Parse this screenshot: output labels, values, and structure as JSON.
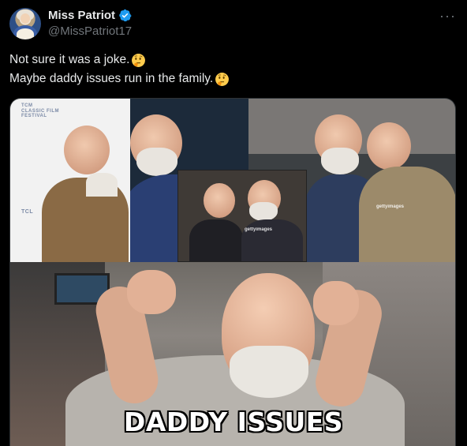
{
  "post": {
    "author": {
      "display_name": "Miss Patriot",
      "handle": "@MissPatriot17",
      "verified": true,
      "avatar_icon": "avatar-photo"
    },
    "more_label": "···",
    "text_lines": [
      "Not sure it was a joke.",
      "Maybe daddy issues run in the family."
    ],
    "emoji_icon": "thinking-face-emoji"
  },
  "media": {
    "collage_logo_lines": [
      "TCM",
      "CLASSIC FILM",
      "FESTIVAL",
      "TCL"
    ],
    "watermarks": [
      "gettyimages",
      "gettyimages"
    ],
    "caption": "DADDY ISSUES"
  },
  "colors": {
    "background": "#000000",
    "text_primary": "#e7e9ea",
    "text_secondary": "#71767b",
    "verified_blue": "#1d9bf0",
    "emoji_yellow": "#ffcc4d"
  }
}
